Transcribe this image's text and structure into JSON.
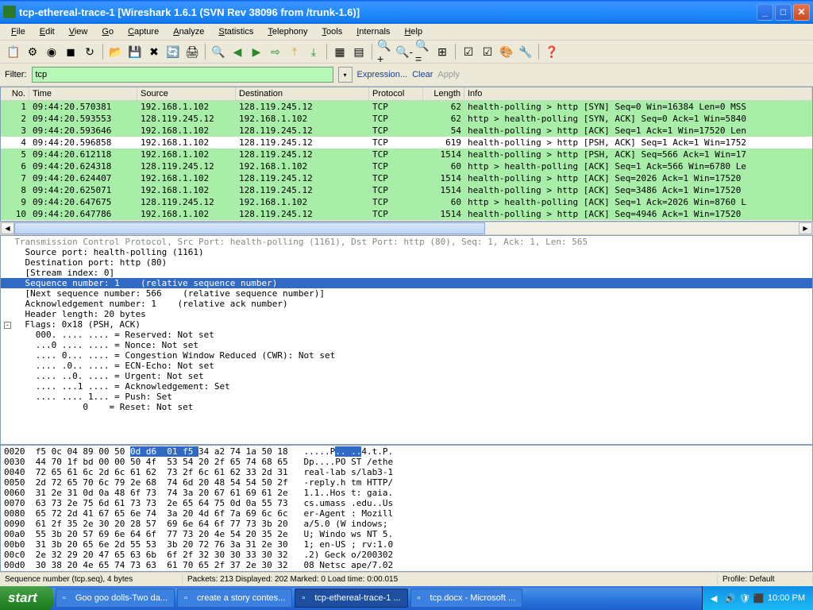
{
  "window": {
    "title": "tcp-ethereal-trace-1   [Wireshark 1.6.1  (SVN Rev 38096 from /trunk-1.6)]"
  },
  "menu": [
    "File",
    "Edit",
    "View",
    "Go",
    "Capture",
    "Analyze",
    "Statistics",
    "Telephony",
    "Tools",
    "Internals",
    "Help"
  ],
  "filter": {
    "label": "Filter:",
    "value": "tcp",
    "expression": "Expression...",
    "clear": "Clear",
    "apply": "Apply"
  },
  "columns": {
    "no": "No.",
    "time": "Time",
    "src": "Source",
    "dst": "Destination",
    "proto": "Protocol",
    "len": "Length",
    "info": "Info"
  },
  "packets": [
    {
      "no": "1",
      "time": "09:44:20.570381",
      "src": "192.168.1.102",
      "dst": "128.119.245.12",
      "proto": "TCP",
      "len": "62",
      "info": "health-polling > http [SYN] Seq=0 Win=16384 Len=0 MSS",
      "cls": "g"
    },
    {
      "no": "2",
      "time": "09:44:20.593553",
      "src": "128.119.245.12",
      "dst": "192.168.1.102",
      "proto": "TCP",
      "len": "62",
      "info": "http > health-polling [SYN, ACK] Seq=0 Ack=1 Win=5840",
      "cls": "g"
    },
    {
      "no": "3",
      "time": "09:44:20.593646",
      "src": "192.168.1.102",
      "dst": "128.119.245.12",
      "proto": "TCP",
      "len": "54",
      "info": "health-polling > http [ACK] Seq=1 Ack=1 Win=17520 Len",
      "cls": "g"
    },
    {
      "no": "4",
      "time": "09:44:20.596858",
      "src": "192.168.1.102",
      "dst": "128.119.245.12",
      "proto": "TCP",
      "len": "619",
      "info": "health-polling > http [PSH, ACK] Seq=1 Ack=1 Win=1752",
      "cls": "w"
    },
    {
      "no": "5",
      "time": "09:44:20.612118",
      "src": "192.168.1.102",
      "dst": "128.119.245.12",
      "proto": "TCP",
      "len": "1514",
      "info": "health-polling > http [PSH, ACK] Seq=566 Ack=1 Win=17",
      "cls": "g"
    },
    {
      "no": "6",
      "time": "09:44:20.624318",
      "src": "128.119.245.12",
      "dst": "192.168.1.102",
      "proto": "TCP",
      "len": "60",
      "info": "http > health-polling [ACK] Seq=1 Ack=566 Win=6780 Le",
      "cls": "g"
    },
    {
      "no": "7",
      "time": "09:44:20.624407",
      "src": "192.168.1.102",
      "dst": "128.119.245.12",
      "proto": "TCP",
      "len": "1514",
      "info": "health-polling > http [ACK] Seq=2026 Ack=1 Win=17520",
      "cls": "g"
    },
    {
      "no": "8",
      "time": "09:44:20.625071",
      "src": "192.168.1.102",
      "dst": "128.119.245.12",
      "proto": "TCP",
      "len": "1514",
      "info": "health-polling > http [ACK] Seq=3486 Ack=1 Win=17520",
      "cls": "g"
    },
    {
      "no": "9",
      "time": "09:44:20.647675",
      "src": "128.119.245.12",
      "dst": "192.168.1.102",
      "proto": "TCP",
      "len": "60",
      "info": "http > health-polling [ACK] Seq=1 Ack=2026 Win=8760 L",
      "cls": "g"
    },
    {
      "no": "10",
      "time": "09:44:20.647786",
      "src": "192.168.1.102",
      "dst": "128.119.245.12",
      "proto": "TCP",
      "len": "1514",
      "info": "health-polling > http [ACK] Seq=4946 Ack=1 Win=17520",
      "cls": "g"
    }
  ],
  "details": {
    "l0": "  Transmission Control Protocol, Src Port: health-polling (1161), Dst Port: http (80), Seq: 1, Ack: 1, Len: 565",
    "l1": "    Source port: health-polling (1161)",
    "l2": "    Destination port: http (80)",
    "l3": "    [Stream index: 0]",
    "l4": "    Sequence number: 1    (relative sequence number)",
    "l5": "    [Next sequence number: 566    (relative sequence number)]",
    "l6": "    Acknowledgement number: 1    (relative ack number)",
    "l7": "    Header length: 20 bytes",
    "l8": "  Flags: 0x18 (PSH, ACK)",
    "l9": "      000. .... .... = Reserved: Not set",
    "l10": "      ...0 .... .... = Nonce: Not set",
    "l11": "      .... 0... .... = Congestion Window Reduced (CWR): Not set",
    "l12": "      .... .0.. .... = ECN-Echo: Not set",
    "l13": "      .... ..0. .... = Urgent: Not set",
    "l14": "      .... ...1 .... = Acknowledgement: Set",
    "l15": "      .... .... 1... = Push: Set",
    "l16": "               0    = Reset: Not set"
  },
  "hex": [
    {
      "off": "0020",
      "h1": "f5 0c 04 89 00 50 ",
      "hl": "0d d6  01 f5 ",
      "h2": "34 a2 74 1a 50 18",
      "a1": ".....P",
      "al": ".. ..",
      "a2": "4.t.P."
    },
    {
      "off": "0030",
      "h1": "44 70 1f bd 00 00 50 4f  53 54 20 2f 65 74 68 65",
      "a": "Dp....PO ST /ethe"
    },
    {
      "off": "0040",
      "h1": "72 65 61 6c 2d 6c 61 62  73 2f 6c 61 62 33 2d 31",
      "a": "real-lab s/lab3-1"
    },
    {
      "off": "0050",
      "h1": "2d 72 65 70 6c 79 2e 68  74 6d 20 48 54 54 50 2f",
      "a": "-reply.h tm HTTP/"
    },
    {
      "off": "0060",
      "h1": "31 2e 31 0d 0a 48 6f 73  74 3a 20 67 61 69 61 2e",
      "a": "1.1..Hos t: gaia."
    },
    {
      "off": "0070",
      "h1": "63 73 2e 75 6d 61 73 73  2e 65 64 75 0d 0a 55 73",
      "a": "cs.umass .edu..Us"
    },
    {
      "off": "0080",
      "h1": "65 72 2d 41 67 65 6e 74  3a 20 4d 6f 7a 69 6c 6c",
      "a": "er-Agent : Mozill"
    },
    {
      "off": "0090",
      "h1": "61 2f 35 2e 30 20 28 57  69 6e 64 6f 77 73 3b 20",
      "a": "a/5.0 (W indows; "
    },
    {
      "off": "00a0",
      "h1": "55 3b 20 57 69 6e 64 6f  77 73 20 4e 54 20 35 2e",
      "a": "U; Windo ws NT 5."
    },
    {
      "off": "00b0",
      "h1": "31 3b 20 65 6e 2d 55 53  3b 20 72 76 3a 31 2e 30",
      "a": "1; en-US ; rv:1.0"
    },
    {
      "off": "00c0",
      "h1": "2e 32 29 20 47 65 63 6b  6f 2f 32 30 30 33 30 32",
      "a": ".2) Geck o/200302"
    },
    {
      "off": "00d0",
      "h1": "30 38 20 4e 65 74 73 63  61 70 65 2f 37 2e 30 32",
      "a": "08 Netsc ape/7.02"
    }
  ],
  "status": {
    "left": "Sequence number (tcp.seq), 4 bytes",
    "mid": "Packets: 213 Displayed: 202 Marked: 0 Load time: 0:00.015",
    "right": "Profile: Default"
  },
  "taskbar": {
    "start": "start",
    "items": [
      "Goo goo dolls-Two da...",
      "create a story contes...",
      "tcp-ethereal-trace-1 ...",
      "tcp.docx - Microsoft ..."
    ],
    "time": "10:00 PM"
  }
}
